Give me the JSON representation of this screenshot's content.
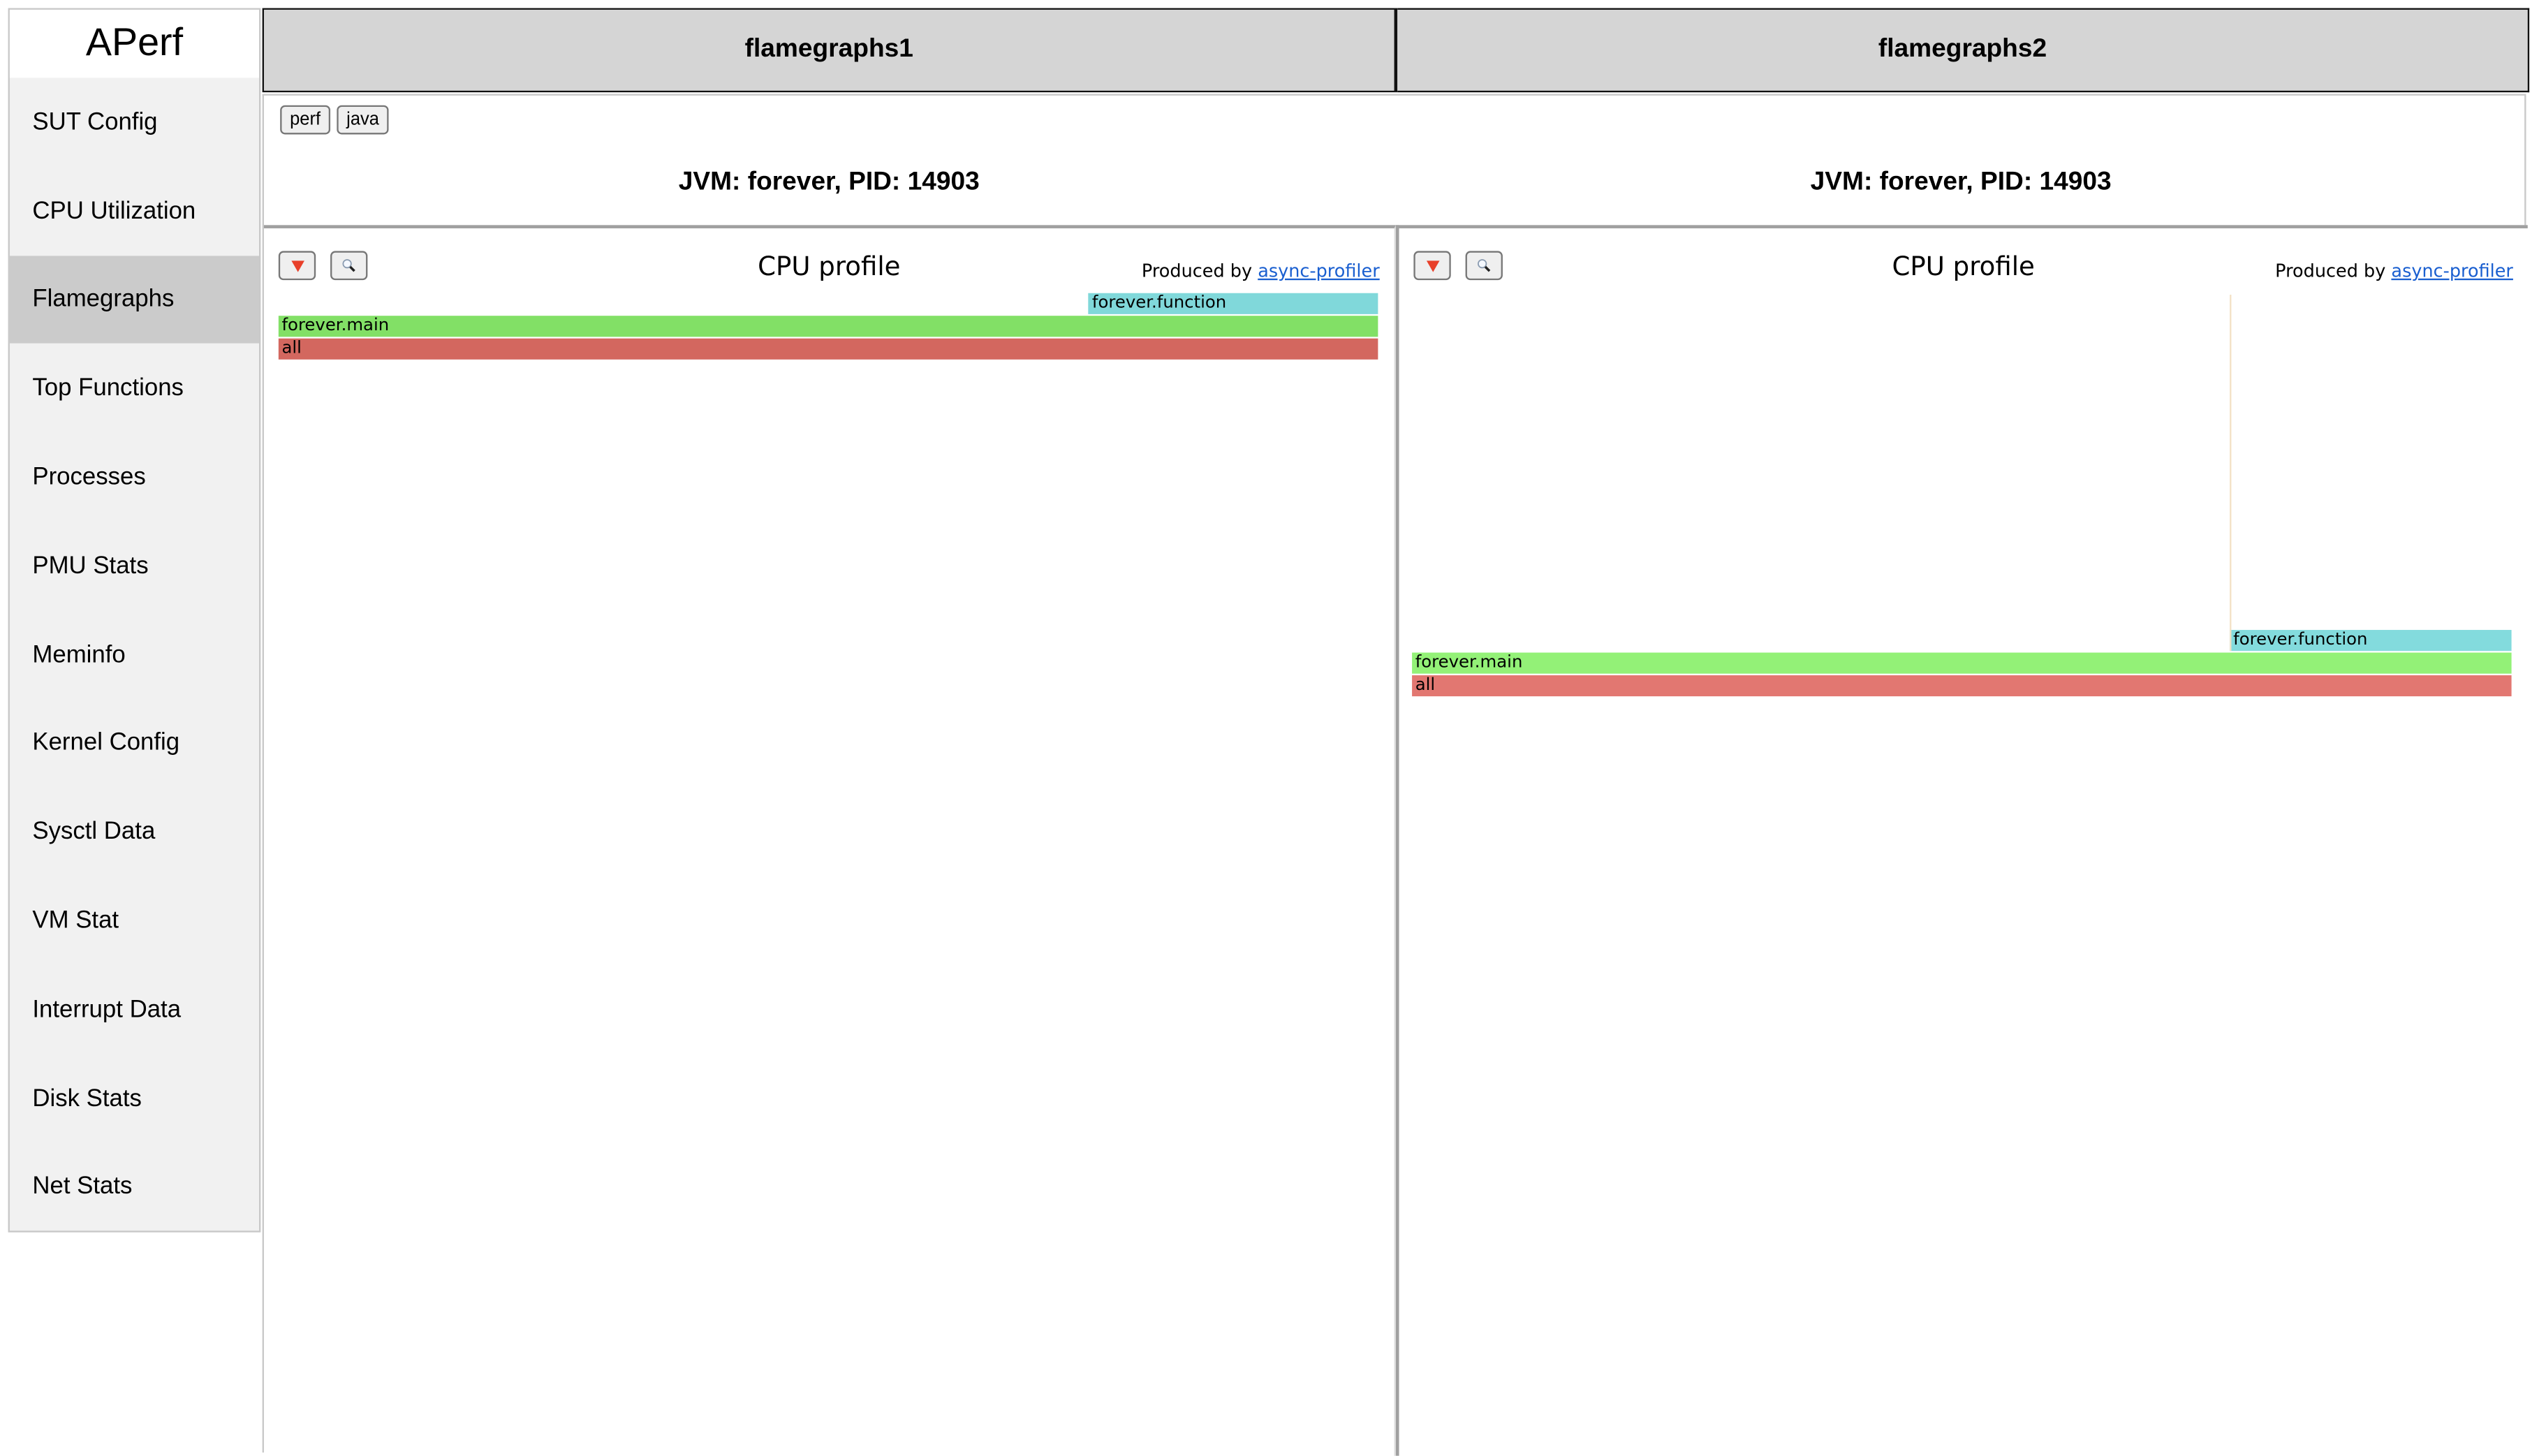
{
  "app": {
    "title": "APerf"
  },
  "sidebar": {
    "items": [
      {
        "label": "SUT Config",
        "active": false
      },
      {
        "label": "CPU Utilization",
        "active": false
      },
      {
        "label": "Flamegraphs",
        "active": true
      },
      {
        "label": "Top Functions",
        "active": false
      },
      {
        "label": "Processes",
        "active": false
      },
      {
        "label": "PMU Stats",
        "active": false
      },
      {
        "label": "Meminfo",
        "active": false
      },
      {
        "label": "Kernel Config",
        "active": false
      },
      {
        "label": "Sysctl Data",
        "active": false
      },
      {
        "label": "VM Stat",
        "active": false
      },
      {
        "label": "Interrupt Data",
        "active": false
      },
      {
        "label": "Disk Stats",
        "active": false
      },
      {
        "label": "Net Stats",
        "active": false
      }
    ]
  },
  "tabs": [
    {
      "label": "flamegraphs1"
    },
    {
      "label": "flamegraphs2"
    }
  ],
  "subtabs": [
    {
      "label": "perf"
    },
    {
      "label": "java"
    }
  ],
  "colors": {
    "all": "#d3675f",
    "main": "#82e066",
    "function": "#80d8da",
    "all_right": "#e27771",
    "main_right": "#93f177",
    "function_right": "#83dbdd",
    "link": "#1a5fd0",
    "active_nav": "#cbcbcb"
  },
  "panels": [
    {
      "jvm_title": "JVM: forever, PID: 14903",
      "profile_title": "CPU profile",
      "produced_by": "Produced by",
      "produced_link": "async-profiler",
      "frames": [
        {
          "name": "all",
          "start": 0.0,
          "width": 1.0,
          "depth": 0
        },
        {
          "name": "forever.main",
          "start": 0.0,
          "width": 1.0,
          "depth": 1
        },
        {
          "name": "forever.function",
          "start": 0.737,
          "width": 0.263,
          "depth": 2
        }
      ]
    },
    {
      "jvm_title": "JVM: forever, PID: 14903",
      "profile_title": "CPU profile",
      "produced_by": "Produced by",
      "produced_link": "async-profiler",
      "frames": [
        {
          "name": "all",
          "start": 0.0,
          "width": 1.0,
          "depth": 0
        },
        {
          "name": "forever.main",
          "start": 0.0,
          "width": 1.0,
          "depth": 1
        },
        {
          "name": "forever.function",
          "start": 0.744,
          "width": 0.256,
          "depth": 2
        }
      ],
      "thin_stack_depth": 17
    }
  ]
}
